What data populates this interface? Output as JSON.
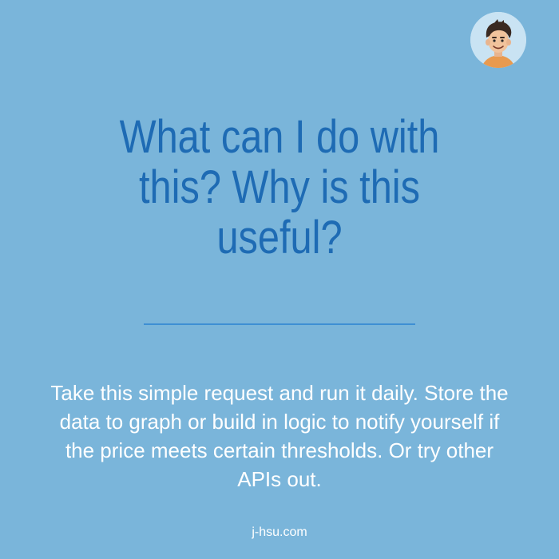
{
  "headline": {
    "text": "What can I do with this? Why is this useful?"
  },
  "body": {
    "text": "Take this simple request and run it daily. Store the data to graph or build in logic to notify yourself if the price meets certain thresholds. Or try other APIs out."
  },
  "footer": {
    "text": "j-hsu.com"
  },
  "avatar": {
    "icon": "cartoon-avatar-icon"
  },
  "colors": {
    "background": "#7ab5da",
    "headline": "#1e6bb4",
    "divider": "#3e8fd3",
    "body_text": "#ffffff"
  }
}
